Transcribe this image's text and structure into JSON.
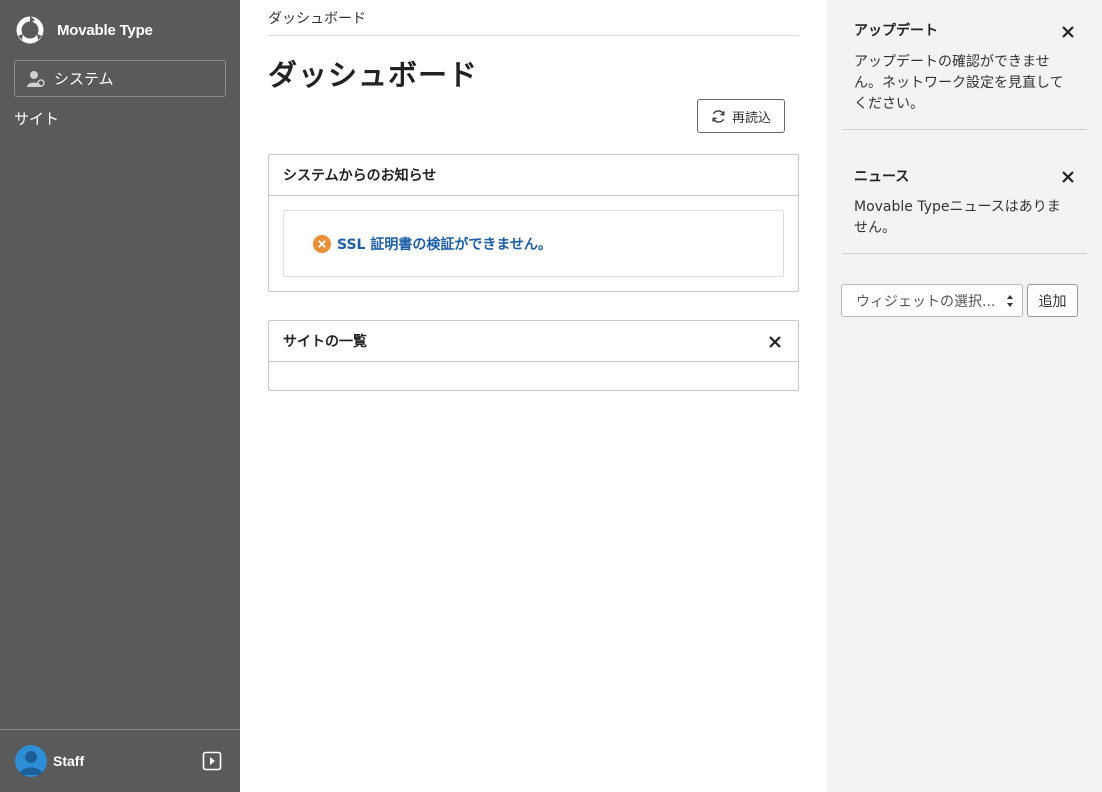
{
  "sidebar": {
    "brand": "Movable Type",
    "system_label": "システム",
    "site_label": "サイト",
    "user_name": "Staff"
  },
  "main": {
    "breadcrumb": "ダッシュボード",
    "title": "ダッシュボード",
    "reload_label": "再読込",
    "notice_panel": {
      "title": "システムからのお知らせ",
      "message": "SSL 証明書の検証ができません。"
    },
    "sites_panel": {
      "title": "サイトの一覧"
    }
  },
  "right": {
    "update_widget": {
      "title": "アップデート",
      "body": "アップデートの確認ができません。ネットワーク設定を見直してください。"
    },
    "news_widget": {
      "title": "ニュース",
      "body": "Movable Typeニュースはありません。"
    },
    "widget_select_value": "ウィジェットの選択...",
    "add_label": "追加"
  },
  "colors": {
    "sidebar_bg": "#5a5a5a",
    "right_bg": "#f3f3f3",
    "error_icon": "#e8913a",
    "notice_link": "#1c5fa6",
    "avatar_bg": "#2f8fd6"
  }
}
